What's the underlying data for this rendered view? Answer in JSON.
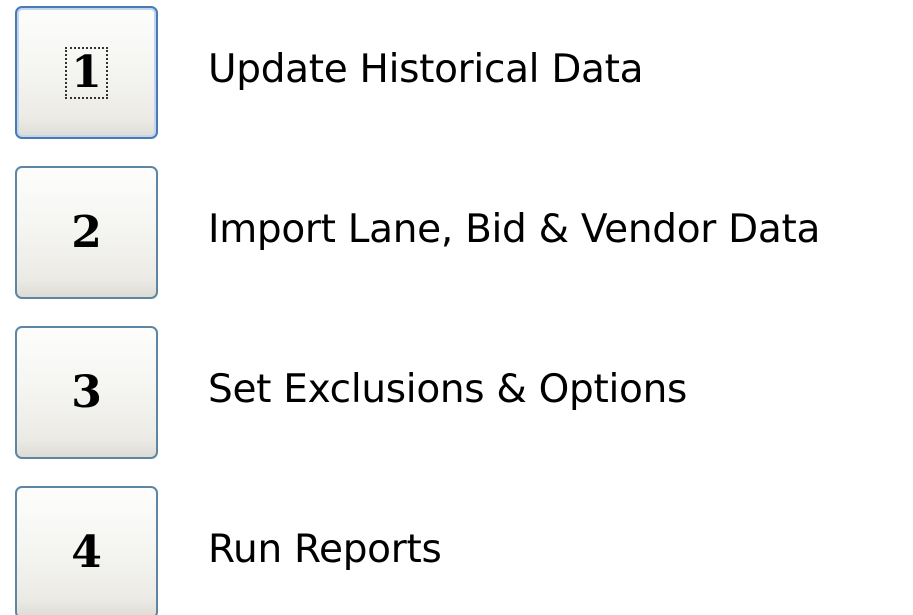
{
  "steps": [
    {
      "number": "1",
      "label": "Update Historical Data",
      "focused": true
    },
    {
      "number": "2",
      "label": "Import Lane, Bid & Vendor Data",
      "focused": false
    },
    {
      "number": "3",
      "label": "Set Exclusions & Options",
      "focused": false
    },
    {
      "number": "4",
      "label": "Run Reports",
      "focused": false
    }
  ]
}
